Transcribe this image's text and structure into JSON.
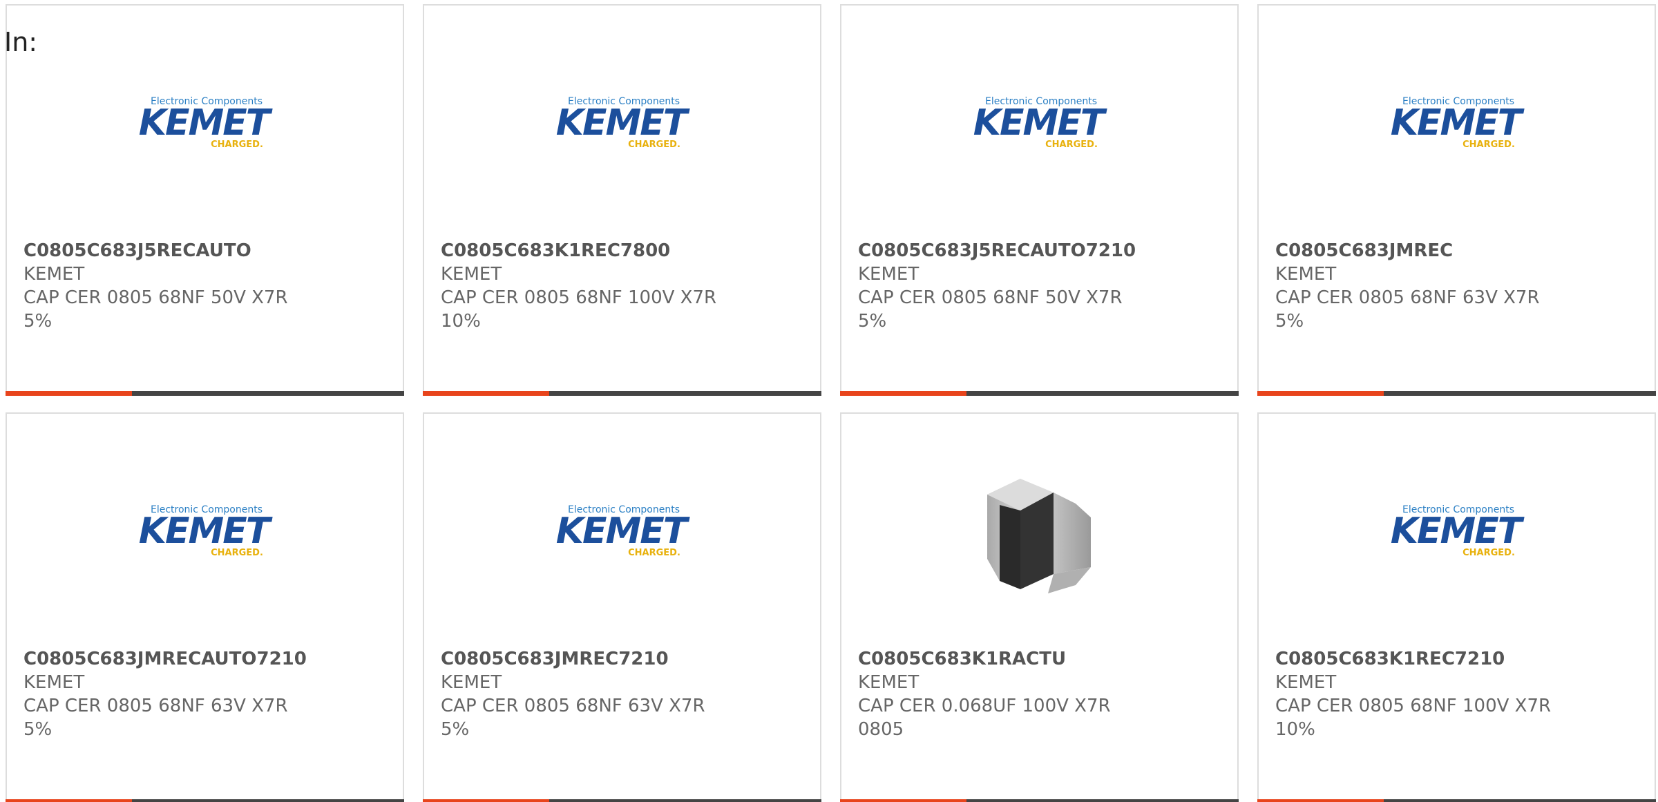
{
  "header": {
    "label": "In:"
  },
  "colors": {
    "accent": "#e8441c",
    "bar": "#444444",
    "kemet_blue": "#1c4f9c",
    "kemet_yellow": "#e8b10d"
  },
  "logo_text": {
    "tagline": "Electronic Components",
    "brand": "KEMET",
    "slogan": "CHARGED."
  },
  "products": [
    {
      "part_number": "C0805C683J5RECAUTO",
      "manufacturer": "KEMET",
      "description": "CAP CER 0805 68NF 50V X7R 5%",
      "image": "kemet-logo"
    },
    {
      "part_number": "C0805C683K1REC7800",
      "manufacturer": "KEMET",
      "description": "CAP CER 0805 68NF 100V X7R 10%",
      "image": "kemet-logo"
    },
    {
      "part_number": "C0805C683J5RECAUTO7210",
      "manufacturer": "KEMET",
      "description": "CAP CER 0805 68NF 50V X7R 5%",
      "image": "kemet-logo"
    },
    {
      "part_number": "C0805C683JMREC",
      "manufacturer": "KEMET",
      "description": "CAP CER 0805 68NF 63V X7R 5%",
      "image": "kemet-logo"
    },
    {
      "part_number": "C0805C683JMRECAUTO7210",
      "manufacturer": "KEMET",
      "description": "CAP CER 0805 68NF 63V X7R 5%",
      "image": "kemet-logo"
    },
    {
      "part_number": "C0805C683JMREC7210",
      "manufacturer": "KEMET",
      "description": "CAP CER 0805 68NF 63V X7R 5%",
      "image": "kemet-logo"
    },
    {
      "part_number": "C0805C683K1RACTU",
      "manufacturer": "KEMET",
      "description": "CAP CER 0.068UF 100V X7R 0805",
      "image": "chip-capacitor"
    },
    {
      "part_number": "C0805C683K1REC7210",
      "manufacturer": "KEMET",
      "description": "CAP CER 0805 68NF 100V X7R 10%",
      "image": "kemet-logo"
    }
  ]
}
